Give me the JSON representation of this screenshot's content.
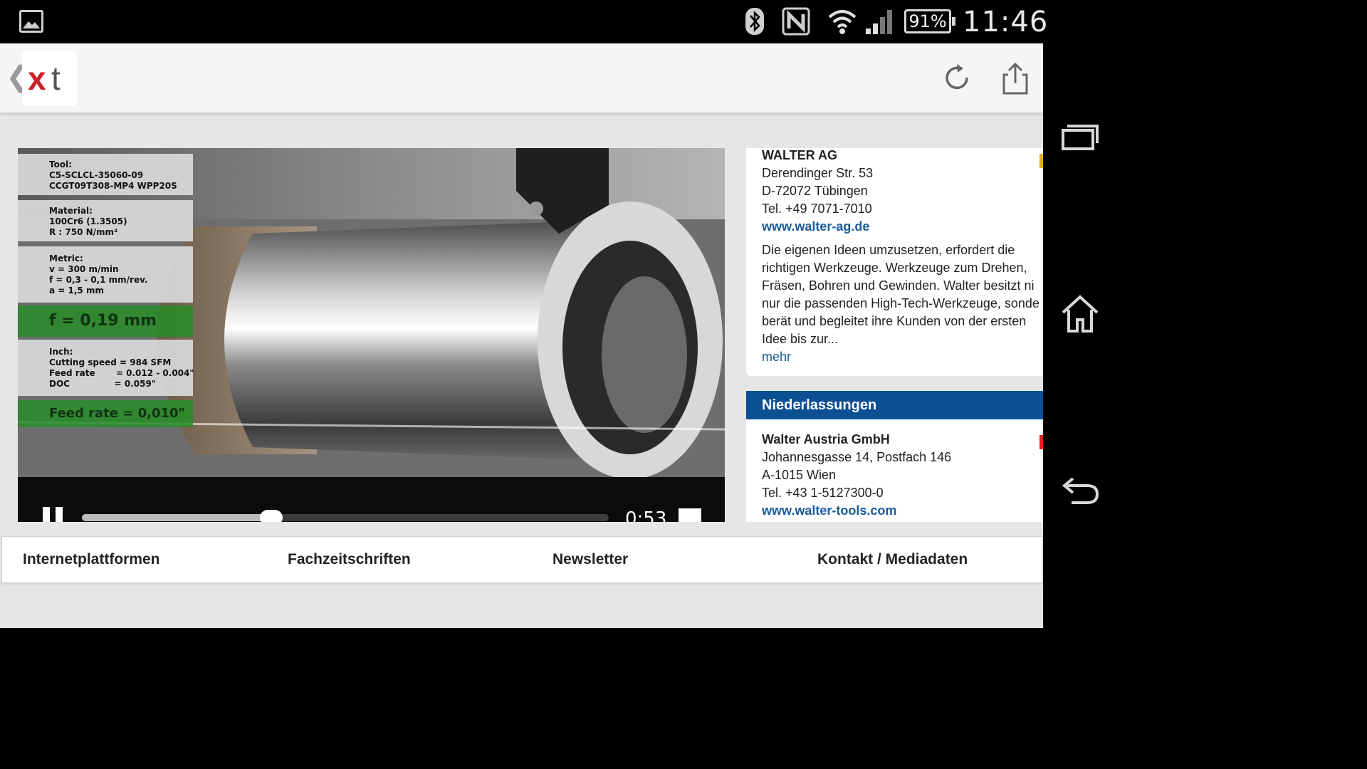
{
  "status_bar": {
    "battery": "91%",
    "time": "11:46"
  },
  "colors": {
    "logo_red": "#cc1f2a",
    "link_blue": "#1a5a9b",
    "header_blue": "#0d4f93"
  },
  "header": {
    "logo_x": "x",
    "logo_t": "t"
  },
  "video": {
    "tool_label": "Tool:",
    "tool_1": "C5-SCLCL-35060-09",
    "tool_2": "CCGT09T308-MP4 WPP20S",
    "material_label": "Material:",
    "material_1": "100Cr6 (1.3505)",
    "material_2": "R : 750 N/mm²",
    "metric_label": "Metric:",
    "metric_1": "v = 300 m/min",
    "metric_2": "f = 0,3 - 0,1 mm/rev.",
    "metric_3": "a = 1,5 mm",
    "feed_mm": "f =  0,19 mm",
    "inch_label": "Inch:",
    "inch_1": "Cutting speed = 984 SFM",
    "inch_2": "Feed rate       = 0.012 - 0.004\"",
    "inch_3": "DOC               = 0.059\"",
    "feed_inch": "Feed rate = 0,010\"",
    "time": "0:53",
    "progress": 0.36
  },
  "company": {
    "name": "WALTER AG",
    "street": "Derendinger Str. 53",
    "city": "D-72072 Tübingen",
    "phone": "Tel. +49 7071-7010",
    "website": "www.walter-ag.de",
    "desc_1": "Die eigenen Ideen umzusetzen, erfordert die",
    "desc_2": "richtigen Werkzeuge. Werkzeuge zum Drehen,",
    "desc_3": "Fräsen, Bohren und Gewinden. Walter besitzt ni",
    "desc_4": "nur die passenden High-Tech-Werkzeuge, sonde",
    "desc_5": "berät und begleitet ihre Kunden von der ersten",
    "desc_6": "Idee bis zur...",
    "more": "mehr"
  },
  "branches": {
    "heading": "Niederlassungen",
    "name": "Walter Austria GmbH",
    "street": "Johannesgasse 14, Postfach 146",
    "city": "A-1015 Wien",
    "phone": "Tel. +43 1-5127300-0",
    "website": "www.walter-tools.com"
  },
  "bottom_nav": {
    "items": [
      "Internetplattformen",
      "Fachzeitschriften",
      "Newsletter",
      "Kontakt / Mediadaten"
    ]
  }
}
